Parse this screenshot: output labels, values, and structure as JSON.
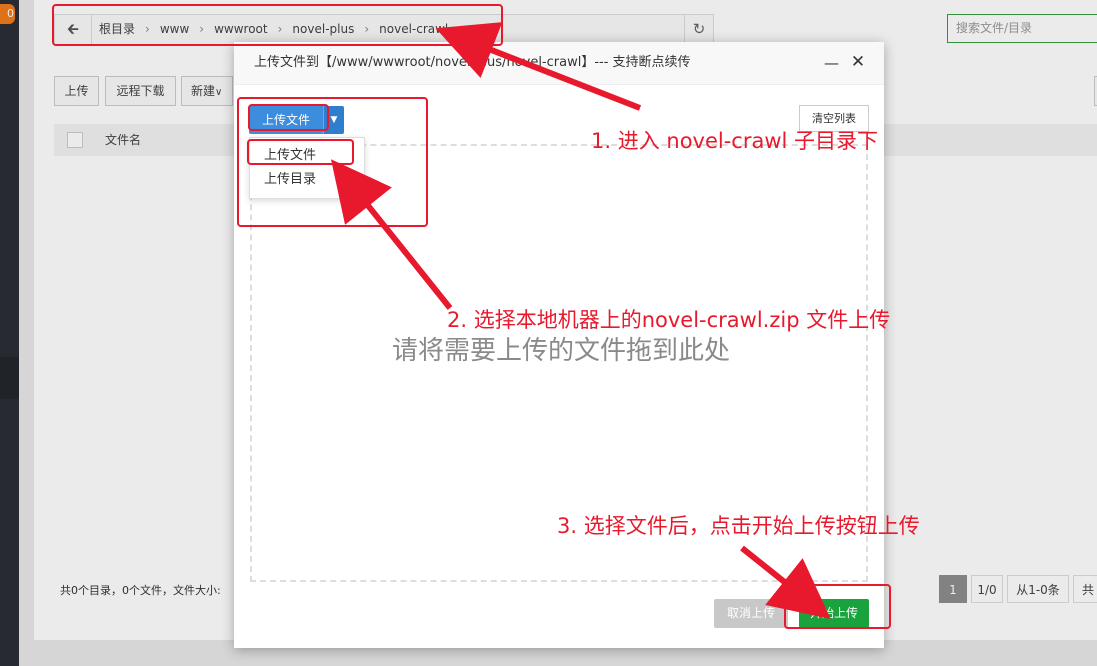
{
  "sidebar": {
    "badge": "0"
  },
  "breadcrumb": {
    "items": [
      "根目录",
      "www",
      "wwwroot",
      "novel-plus",
      "novel-crawl"
    ],
    "separator": "›"
  },
  "search": {
    "placeholder": "搜索文件/目录"
  },
  "toolbar": {
    "upload": "上传",
    "remote_download": "远程下载",
    "new": "新建"
  },
  "table": {
    "header_name": "文件名"
  },
  "footer": {
    "summary": "共0个目录，0个文件，文件大小:"
  },
  "pager": {
    "page": "1",
    "total": "1/0",
    "range": "从1-0条",
    "count_prefix": "共"
  },
  "dialog": {
    "title": "上传文件到【/www/wwwroot/novel-plus/novel-crawl】--- 支持断点续传",
    "upload_button": "上传文件",
    "menu": [
      "上传文件",
      "上传目录"
    ],
    "clear_list": "清空列表",
    "drop_hint": "请将需要上传的文件拖到此处",
    "cancel": "取消上传",
    "start": "开始上传"
  },
  "annotations": {
    "step1": "1. 进入 novel-crawl 子目录下",
    "step2": "2. 选择本地机器上的novel-crawl.zip 文件上传",
    "step3": "3. 选择文件后，点击开始上传按钮上传",
    "color": "#e8192c"
  },
  "colors": {
    "primary": "#3c8dde",
    "success": "#1aa33d",
    "search_border": "#3a9d43"
  }
}
